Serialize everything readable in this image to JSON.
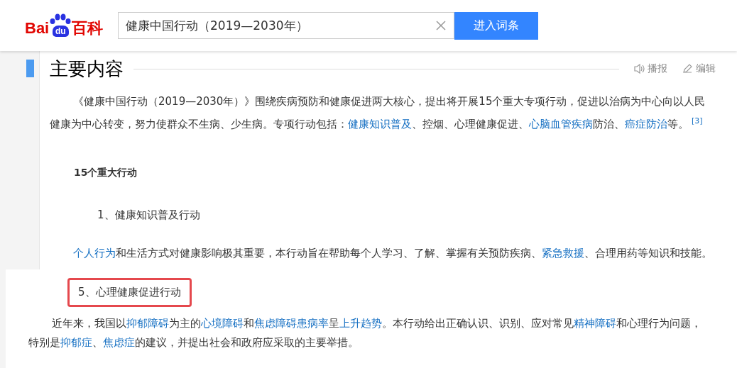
{
  "header": {
    "logo": {
      "left": "Bai",
      "badge": "du",
      "right": "百科"
    },
    "search": {
      "value": "健康中国行动（2019—2030年）"
    },
    "submit": "进入词条"
  },
  "section": {
    "title": "主要内容",
    "actions": [
      {
        "kind": "speaker",
        "label": "播报"
      },
      {
        "kind": "pencil",
        "label": "编辑"
      }
    ]
  },
  "blocks": [
    {
      "kind": "paragraph",
      "segments": [
        {
          "text": "《健康中国行动（2019—2030年）》围绕疾病预防和健康促进两大核心，提出将开展15个重大专项行动，促进以治病为中心向以人民健康为中心转变，努力使群众不生病、少生病。专项行动包括：",
          "link": false
        },
        {
          "text": "健康知识普及",
          "link": true
        },
        {
          "text": "、控烟、心理健康促进、",
          "link": false
        },
        {
          "text": "心脑血管疾病",
          "link": true
        },
        {
          "text": "防治、",
          "link": false
        },
        {
          "text": "癌症防治",
          "link": true
        },
        {
          "text": "等。",
          "link": false
        }
      ],
      "ref": "[3]"
    },
    {
      "kind": "heading",
      "text": "15个重大行动"
    },
    {
      "kind": "subheading",
      "text": "1、健康知识普及行动",
      "highlighted": false
    },
    {
      "kind": "paragraph",
      "segments": [
        {
          "text": "个人行为",
          "link": true
        },
        {
          "text": "和生活方式对健康影响极其重要，本行动旨在帮助每个人学习、了解、掌握有关预防疾病、",
          "link": false
        },
        {
          "text": "紧急救援",
          "link": true
        },
        {
          "text": "、合理用药等知识和技能。",
          "link": false
        }
      ]
    }
  ],
  "excerpt": {
    "blocks": [
      {
        "kind": "subheading",
        "text": "5、心理健康促进行动",
        "highlighted": true
      },
      {
        "kind": "paragraph",
        "segments": [
          {
            "text": "近年来，我国以",
            "link": false
          },
          {
            "text": "抑郁障碍",
            "link": true
          },
          {
            "text": "为主的",
            "link": false
          },
          {
            "text": "心境障碍",
            "link": true
          },
          {
            "text": "和",
            "link": false
          },
          {
            "text": "焦虑障碍患病率",
            "link": true
          },
          {
            "text": "呈",
            "link": false
          },
          {
            "text": "上升趋势",
            "link": true
          },
          {
            "text": "。本行动给出正确认识、识别、应对常见",
            "link": false
          },
          {
            "text": "精神障碍",
            "link": true
          },
          {
            "text": "和心理行为问题，特别是",
            "link": false
          },
          {
            "text": "抑郁症",
            "link": true
          },
          {
            "text": "、",
            "link": false
          },
          {
            "text": "焦虑症",
            "link": true
          },
          {
            "text": "的建议，并提出社会和政府应采取的主要举措。",
            "link": false
          }
        ]
      }
    ]
  }
}
